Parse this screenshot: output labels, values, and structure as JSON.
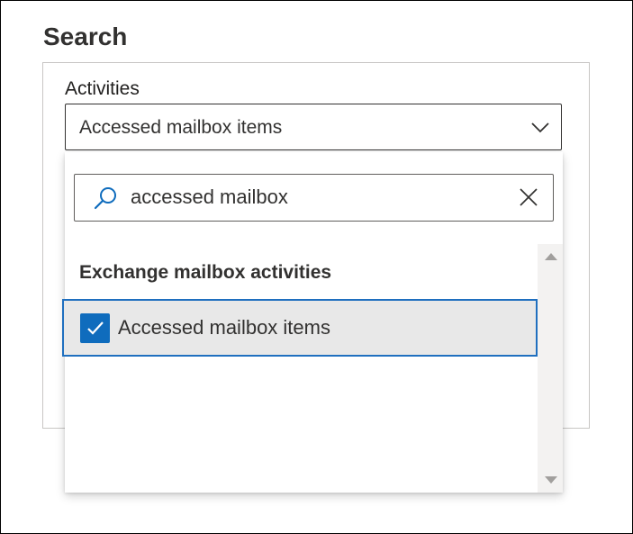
{
  "page": {
    "title": "Search"
  },
  "activities": {
    "label": "Activities",
    "selected_value": "Accessed mailbox items"
  },
  "search": {
    "value": "accessed mailbox"
  },
  "results": {
    "group_header": "Exchange mailbox activities",
    "options": [
      {
        "label": "Accessed mailbox items",
        "checked": true
      }
    ]
  },
  "icons": {
    "dropdown": "chevron-down-icon",
    "search": "search-icon",
    "clear": "close-icon",
    "check": "checkmark-icon",
    "scroll_up": "scroll-up-arrow-icon",
    "scroll_down": "scroll-down-arrow-icon"
  },
  "colors": {
    "accent": "#0f6cbd",
    "selected_row_bg": "#e8e8e8",
    "selected_row_border": "#1f6fbf",
    "text": "#323130"
  }
}
